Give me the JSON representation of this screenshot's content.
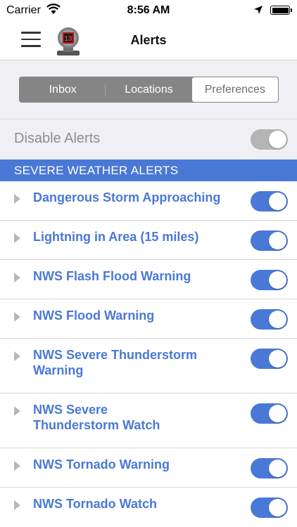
{
  "status_bar": {
    "carrier": "Carrier",
    "time": "8:56 AM"
  },
  "nav": {
    "title": "Alerts"
  },
  "segments": [
    {
      "label": "Inbox",
      "active": false
    },
    {
      "label": "Locations",
      "active": false
    },
    {
      "label": "Preferences",
      "active": true
    }
  ],
  "disable_alerts": {
    "label": "Disable Alerts",
    "enabled": false
  },
  "section": {
    "title": "SEVERE WEATHER ALERTS"
  },
  "alerts": [
    {
      "label": "Dangerous Storm Approaching",
      "on": true
    },
    {
      "label": "Lightning in Area (15 miles)",
      "on": true
    },
    {
      "label": "NWS Flash Flood Warning",
      "on": true
    },
    {
      "label": "NWS Flood Warning",
      "on": true
    },
    {
      "label": "NWS Severe Thunderstorm Warning",
      "on": true
    },
    {
      "label": "NWS Severe Thunderstorm Watch",
      "on": true
    },
    {
      "label": "NWS Tornado Warning",
      "on": true
    },
    {
      "label": "NWS Tornado Watch",
      "on": true
    }
  ],
  "colors": {
    "accent": "#4a78d6",
    "toggle_off": "#b4b4b4",
    "group_background": "#efeff4"
  }
}
